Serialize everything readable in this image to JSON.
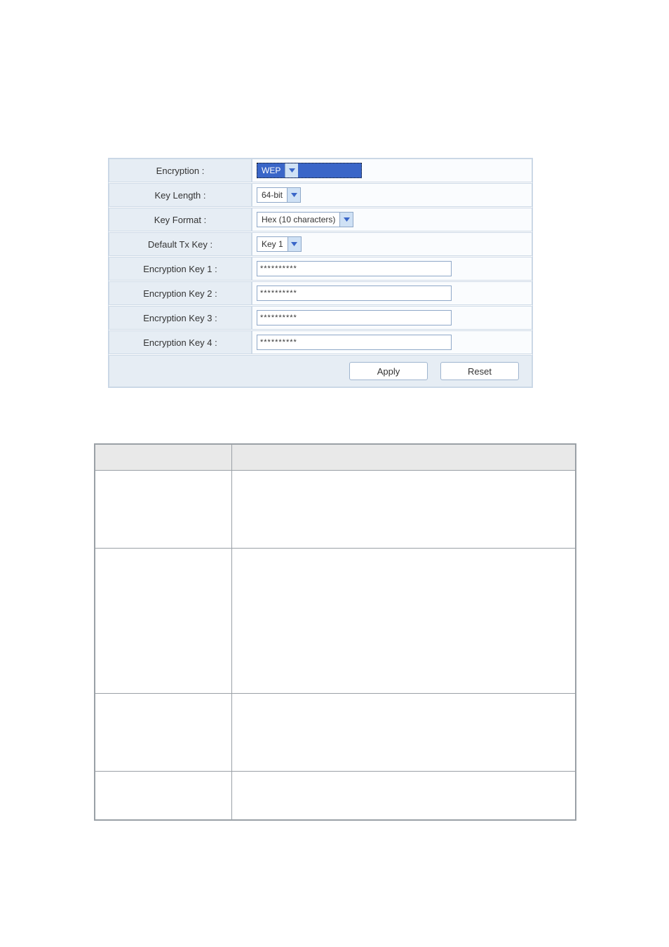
{
  "panel": {
    "rows": {
      "encryption": {
        "label": "Encryption :",
        "value": "WEP"
      },
      "key_length": {
        "label": "Key Length :",
        "value": "64-bit"
      },
      "key_format": {
        "label": "Key Format :",
        "value": "Hex (10 characters)"
      },
      "default_tx": {
        "label": "Default Tx Key :",
        "value": "Key 1"
      },
      "key1": {
        "label": "Encryption Key 1 :",
        "value": "**********"
      },
      "key2": {
        "label": "Encryption Key 2 :",
        "value": "**********"
      },
      "key3": {
        "label": "Encryption Key 3 :",
        "value": "**********"
      },
      "key4": {
        "label": "Encryption Key 4 :",
        "value": "**********"
      }
    },
    "buttons": {
      "apply": "Apply",
      "reset": "Reset"
    }
  }
}
